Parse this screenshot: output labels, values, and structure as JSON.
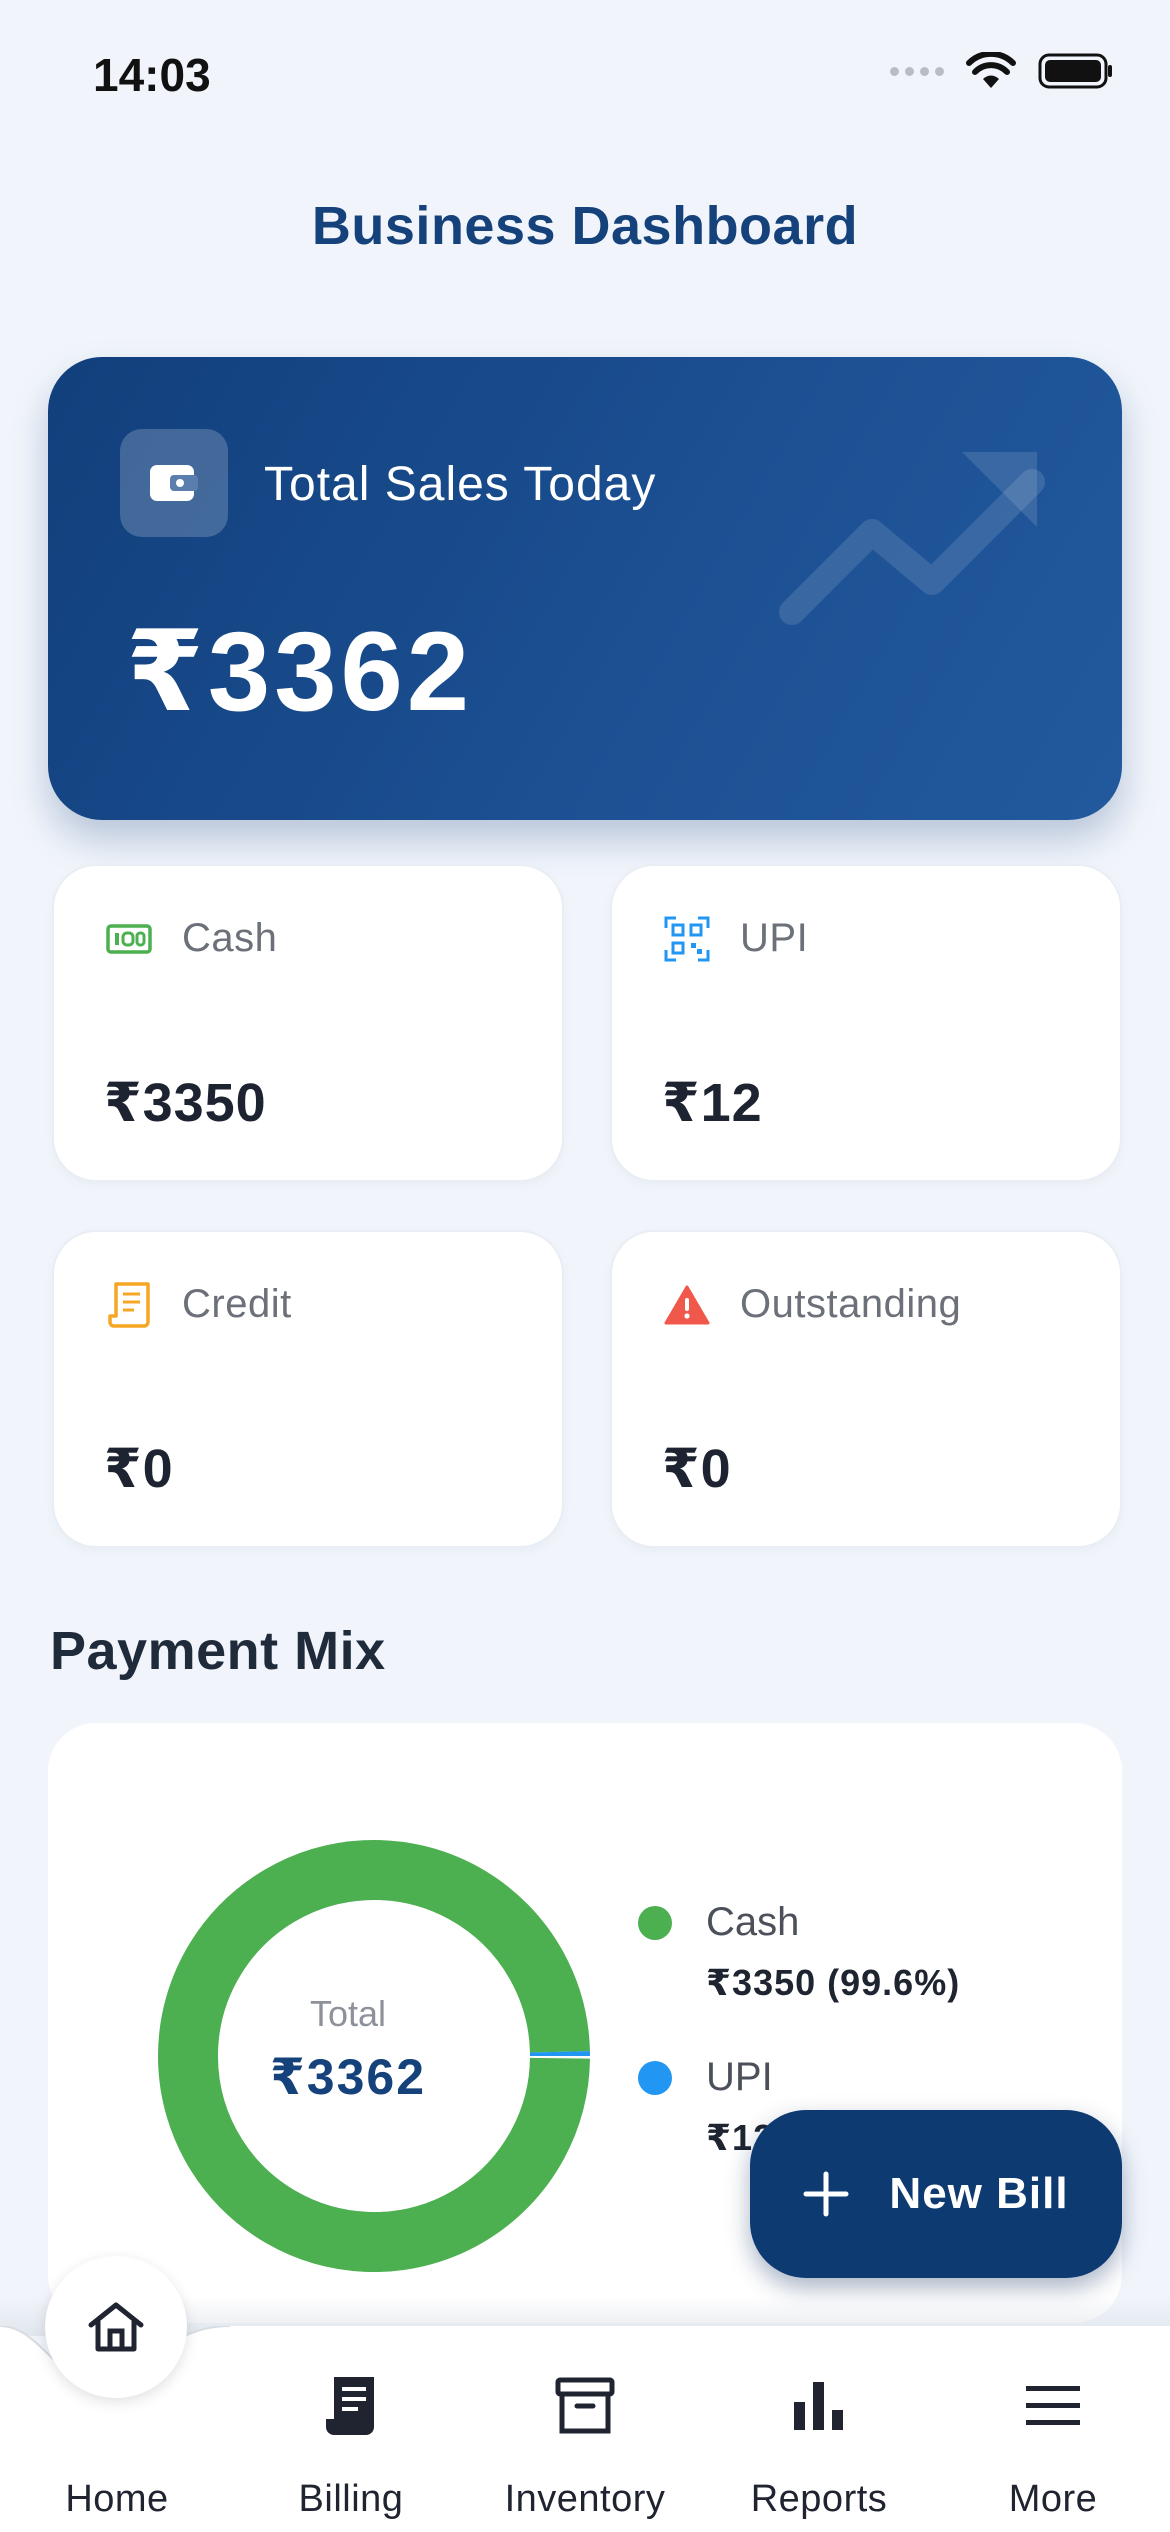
{
  "status_bar": {
    "time": "14:03"
  },
  "header": {
    "title": "Business Dashboard"
  },
  "hero": {
    "icon": "wallet-icon",
    "label": "Total Sales Today",
    "value": "₹3362"
  },
  "stats": [
    {
      "icon": "cash-icon",
      "label": "Cash",
      "value": "₹3350",
      "color": "#4caf50"
    },
    {
      "icon": "qr-code-icon",
      "label": "UPI",
      "value": "₹12",
      "color": "#2196f3"
    },
    {
      "icon": "receipt-icon",
      "label": "Credit",
      "value": "₹0",
      "color": "#f5a623"
    },
    {
      "icon": "warning-icon",
      "label": "Outstanding",
      "value": "₹0",
      "color": "#f0584b"
    }
  ],
  "payment_mix": {
    "title": "Payment Mix",
    "total_label": "Total",
    "total_value": "₹3362",
    "legend": [
      {
        "name": "Cash",
        "value": "₹3350 (99.6%)",
        "color": "#4caf50"
      },
      {
        "name": "UPI",
        "value": "₹12 (0.4%)",
        "color": "#2196f3"
      }
    ]
  },
  "chart_data": {
    "type": "pie",
    "categories": [
      "Cash",
      "UPI"
    ],
    "values": [
      3350,
      12
    ]
  },
  "fab": {
    "icon": "plus-icon",
    "label": "New Bill"
  },
  "bottom_nav": [
    {
      "icon": "home-icon",
      "label": "Home",
      "active": true
    },
    {
      "icon": "billing-icon",
      "label": "Billing"
    },
    {
      "icon": "inventory-icon",
      "label": "Inventory"
    },
    {
      "icon": "reports-icon",
      "label": "Reports"
    },
    {
      "icon": "menu-icon",
      "label": "More"
    }
  ],
  "colors": {
    "primary": "#15427a",
    "accent_dark": "#0e3a72",
    "background": "#f1f5fb"
  }
}
